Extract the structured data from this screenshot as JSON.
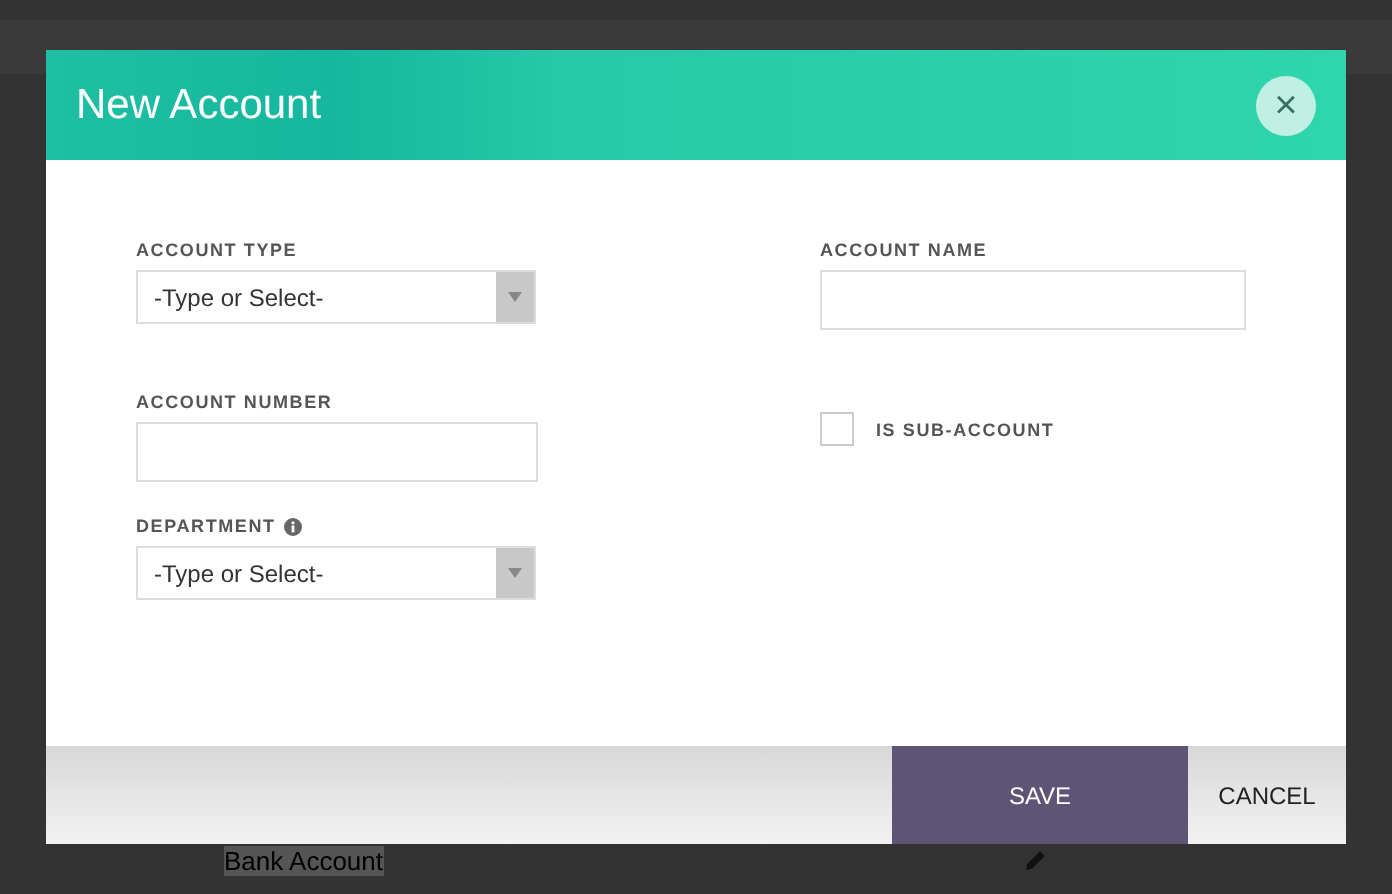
{
  "background": {
    "rows": [
      {
        "name": "Bank Account"
      }
    ]
  },
  "dialog": {
    "title": "New Account",
    "close_icon": "×",
    "left_fields": [
      {
        "kind": "select",
        "label": "ACCOUNT TYPE",
        "placeholder": "-Type or Select-"
      },
      {
        "kind": "text",
        "label": "ACCOUNT NUMBER"
      },
      {
        "kind": "select",
        "label": "DEPARTMENT",
        "placeholder": "-Type or Select-",
        "info": true
      }
    ],
    "right_fields": [
      {
        "kind": "text",
        "label": "ACCOUNT NAME"
      },
      {
        "kind": "checkbox",
        "label": "IS SUB-ACCOUNT",
        "checked": false
      }
    ],
    "buttons": [
      {
        "label": "SAVE",
        "kind": "primary"
      },
      {
        "label": "CANCEL",
        "kind": "secondary"
      }
    ]
  }
}
